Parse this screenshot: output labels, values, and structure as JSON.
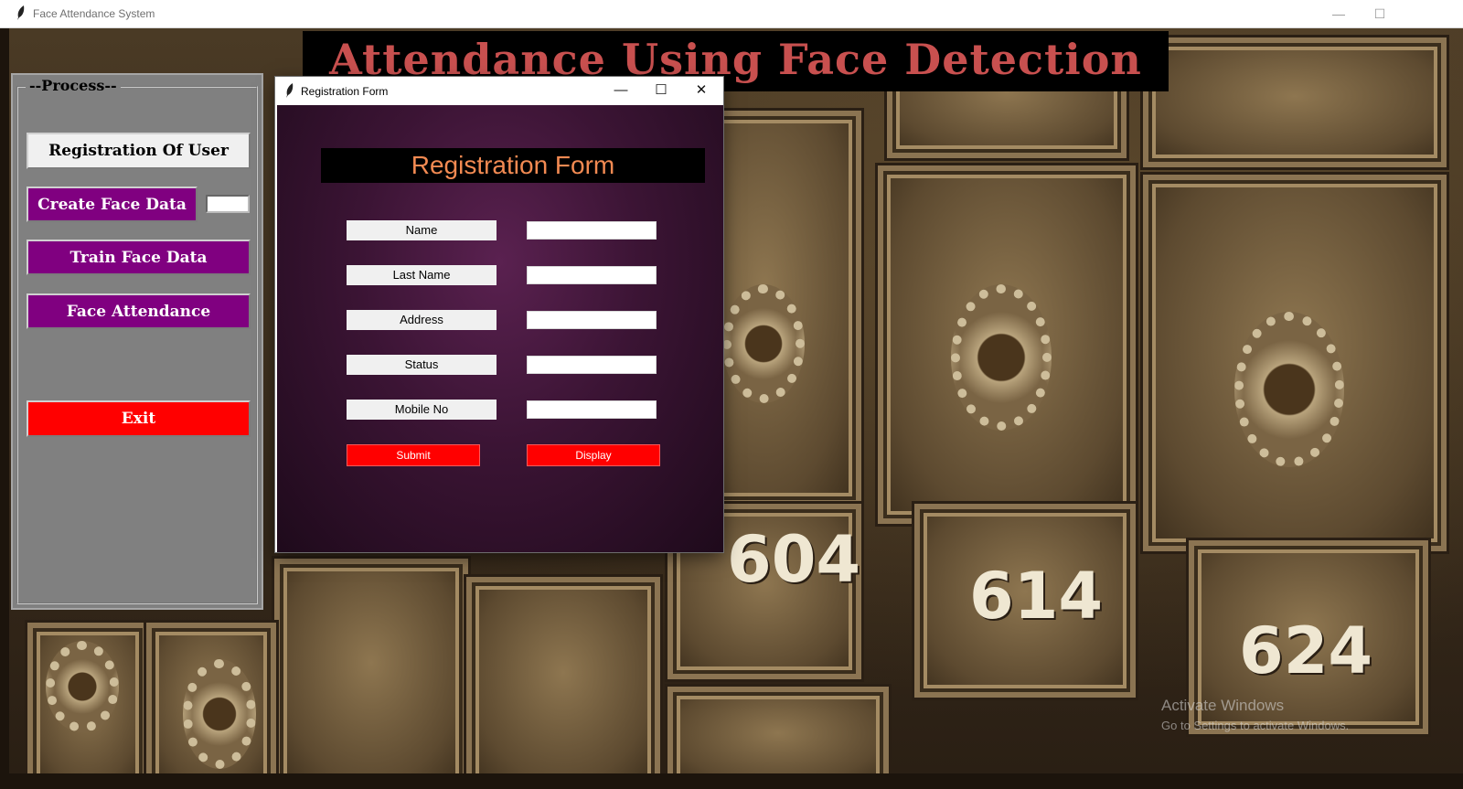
{
  "main_window": {
    "title": "Face Attendance System",
    "controls": {
      "minimize": "—",
      "maximize": "☐"
    }
  },
  "banner": {
    "title": "Attendance Using Face Detection"
  },
  "process_panel": {
    "legend": "--Process--",
    "buttons": {
      "registration": "Registration Of User",
      "create_face_data": "Create Face Data",
      "train_face_data": "Train Face Data",
      "face_attendance": "Face Attendance",
      "exit": "Exit"
    },
    "id_entry_value": ""
  },
  "dialog": {
    "title": "Registration Form",
    "controls": {
      "minimize": "—",
      "maximize": "☐",
      "close": "✕"
    },
    "heading": "Registration Form",
    "fields": [
      {
        "label": "Name",
        "value": ""
      },
      {
        "label": "Last Name",
        "value": ""
      },
      {
        "label": "Address",
        "value": ""
      },
      {
        "label": "Status",
        "value": ""
      },
      {
        "label": "Mobile No",
        "value": ""
      }
    ],
    "buttons": {
      "submit": "Submit",
      "display": "Display"
    }
  },
  "background_box_numbers": [
    "604",
    "614",
    "624"
  ],
  "watermark": {
    "line1": "Activate Windows",
    "line2": "Go to Settings to activate Windows."
  },
  "colors": {
    "banner_text": "#c8504f",
    "purple_button": "#800080",
    "exit_button": "#ff0000",
    "form_heading": "#f28a52"
  }
}
